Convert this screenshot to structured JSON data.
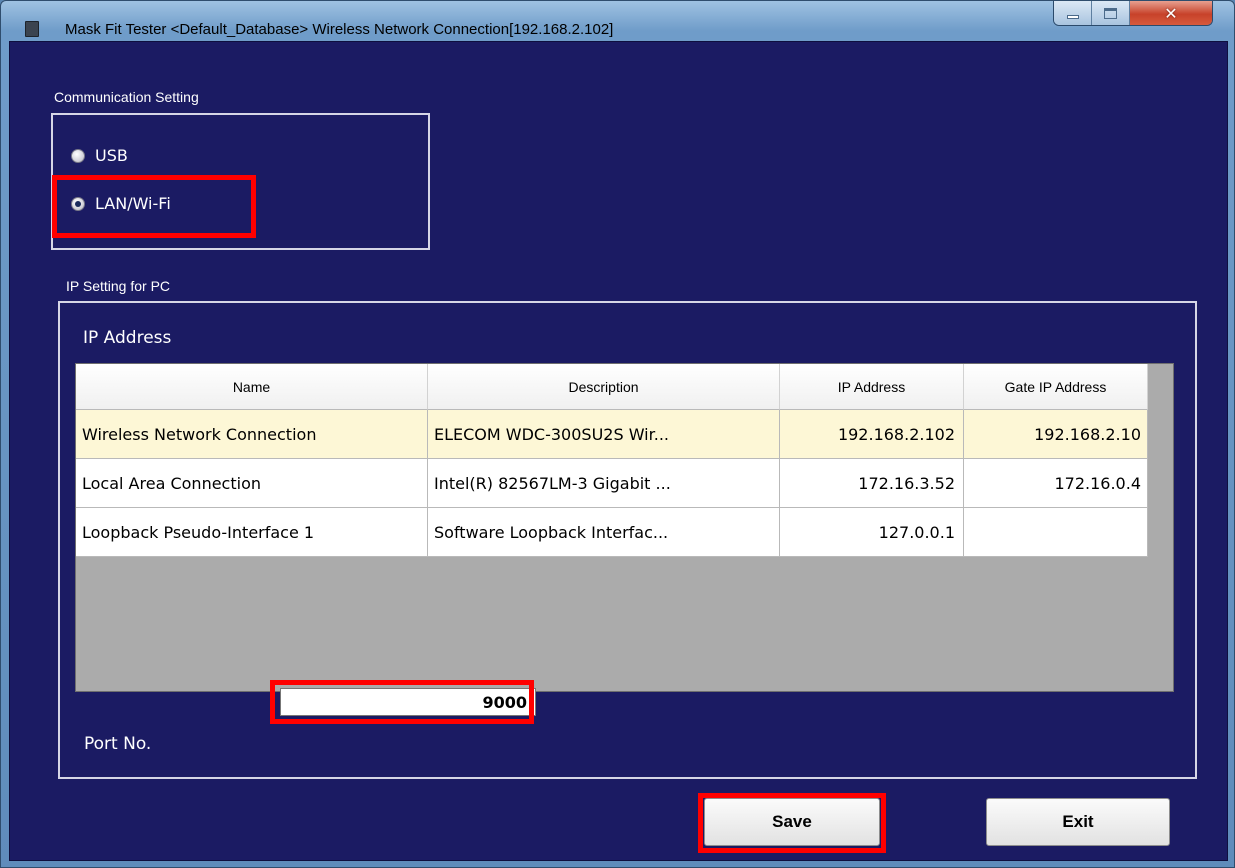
{
  "window": {
    "title": "Mask Fit Tester <Default_Database> Wireless Network Connection[192.168.2.102]",
    "caption": {
      "minimize": "minimize",
      "maximize": "maximize",
      "close": "✕"
    }
  },
  "communication": {
    "group_label": "Communication Setting",
    "options": [
      {
        "label": "USB",
        "checked": false
      },
      {
        "label": "LAN/Wi-Fi",
        "checked": true
      }
    ]
  },
  "ip_setting": {
    "group_label": "IP Setting for PC",
    "section_label": "IP Address",
    "columns": [
      "Name",
      "Description",
      "IP Address",
      "Gate IP Address"
    ],
    "rows": [
      {
        "name": "Wireless Network Connection",
        "description": "ELECOM WDC-300SU2S Wir...",
        "ip": "192.168.2.102",
        "gate": "192.168.2.10",
        "selected": true
      },
      {
        "name": "Local Area Connection",
        "description": "Intel(R) 82567LM-3 Gigabit ...",
        "ip": "172.16.3.52",
        "gate": "172.16.0.4",
        "selected": false
      },
      {
        "name": "Loopback Pseudo-Interface 1",
        "description": "Software Loopback Interfac...",
        "ip": "127.0.0.1",
        "gate": "",
        "selected": false
      }
    ],
    "port_label": "Port No.",
    "port_value": "9000"
  },
  "buttons": {
    "save": "Save",
    "exit": "Exit"
  },
  "colors": {
    "client_bg": "#1b1b63",
    "highlight": "#ff0000",
    "selected_row": "#fdf7d6"
  }
}
